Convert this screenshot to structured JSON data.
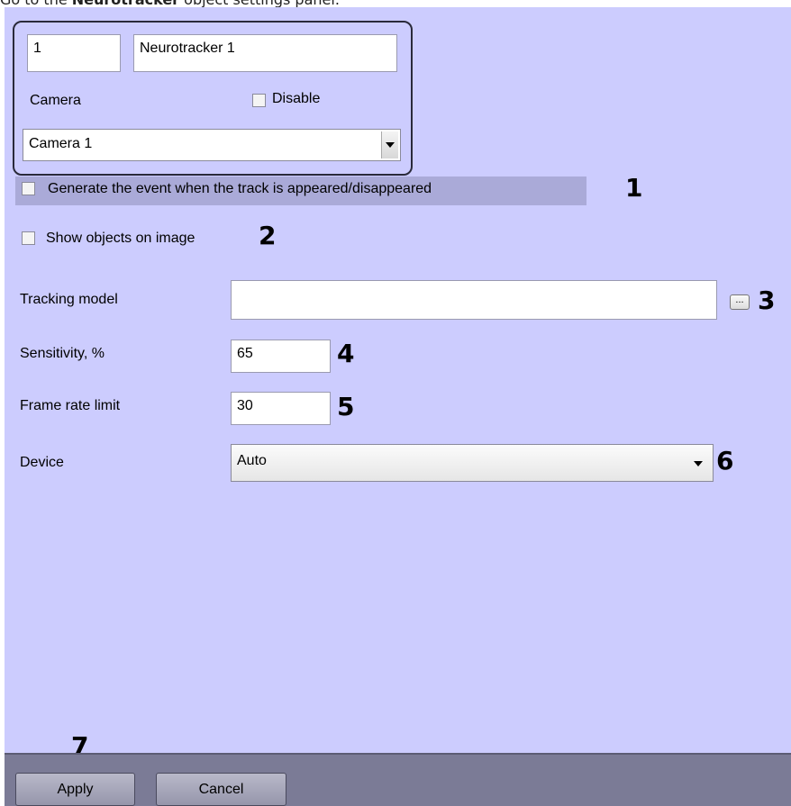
{
  "caption": {
    "prefix": "Go to the ",
    "bold": "Neurotracker",
    "suffix": " object settings panel."
  },
  "object": {
    "id": "1",
    "name": "Neurotracker 1"
  },
  "camera": {
    "label": "Camera",
    "disable_label": "Disable",
    "selected": "Camera 1"
  },
  "options": {
    "generate_event_label": "Generate the event when the track is appeared/disappeared",
    "show_objects_label": "Show objects on image"
  },
  "tracking_model": {
    "label": "Tracking model",
    "value": "",
    "browse_label": "..."
  },
  "sensitivity": {
    "label": "Sensitivity, %",
    "value": "65"
  },
  "frame_rate": {
    "label": "Frame rate limit",
    "value": "30"
  },
  "device": {
    "label": "Device",
    "selected": "Auto"
  },
  "callouts": [
    "1",
    "2",
    "3",
    "4",
    "5",
    "6",
    "7"
  ],
  "buttons": {
    "apply": "Apply",
    "cancel": "Cancel"
  },
  "icons": {
    "dropdown": "chevron-down-icon",
    "checkbox": "checkbox-unchecked-icon"
  },
  "colors": {
    "panel": "#ccccfe",
    "bottom_bar": "#7b7b96",
    "highlight": "#aaaad8"
  }
}
